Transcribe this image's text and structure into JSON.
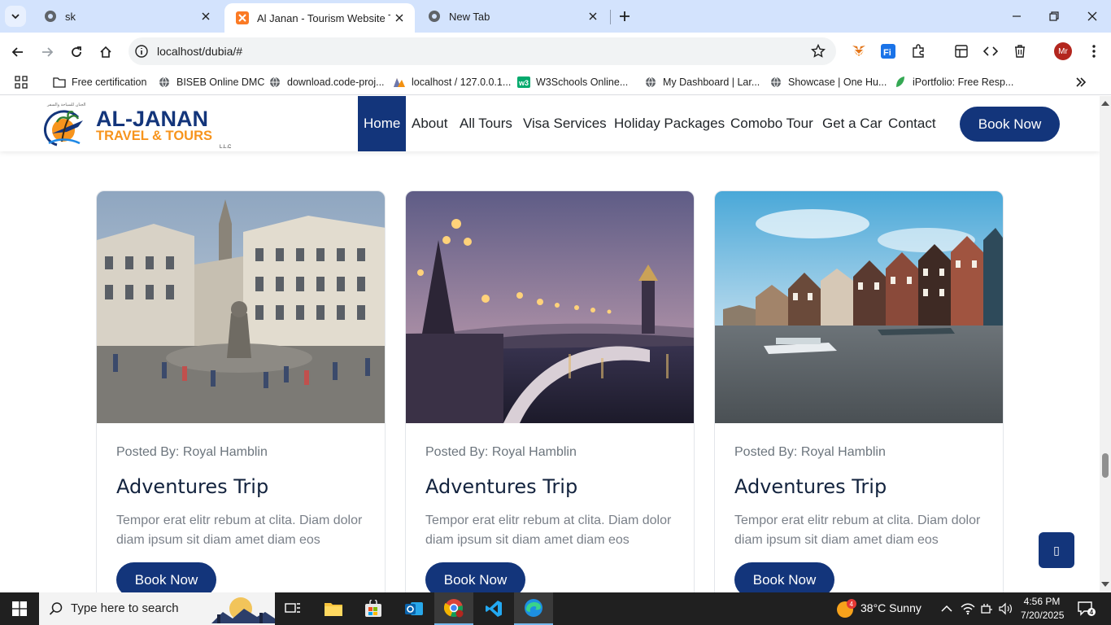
{
  "browser": {
    "tabs": [
      {
        "title": "sk",
        "icon": "chrome-favicon",
        "active": false
      },
      {
        "title": "Al Janan - Tourism Website Ten",
        "icon": "xampp-favicon",
        "active": true
      },
      {
        "title": "New Tab",
        "icon": "chrome-favicon",
        "active": false
      }
    ],
    "url": "localhost/dubia/#",
    "bookmarks": [
      {
        "label": "Free certification",
        "icon": "folder-icon"
      },
      {
        "label": "BISEB Online DMC",
        "icon": "globe-icon"
      },
      {
        "label": "download.code-proj...",
        "icon": "globe-icon"
      },
      {
        "label": "localhost / 127.0.0.1...",
        "icon": "phpmyadmin-icon"
      },
      {
        "label": "W3Schools Online...",
        "icon": "w3schools-icon"
      },
      {
        "label": "My Dashboard | Lar...",
        "icon": "globe-icon"
      },
      {
        "label": "Showcase | One Hu...",
        "icon": "globe-icon"
      },
      {
        "label": "iPortfolio: Free Resp...",
        "icon": "leaf-icon"
      }
    ],
    "profile_initials": "Mr"
  },
  "site": {
    "brand": {
      "name": "AL-JANAN",
      "tagline": "TRAVEL & TOURS",
      "suffix": "L.L.C"
    },
    "nav": [
      {
        "label": "Home",
        "active": true
      },
      {
        "label": "About"
      },
      {
        "label": "All Tours"
      },
      {
        "label": "Visa Services"
      },
      {
        "label": "Holiday Packages"
      },
      {
        "label": "Comobo Tour"
      },
      {
        "label": "Get a Car"
      },
      {
        "label": "Contact"
      }
    ],
    "cta": "Book Now",
    "cards": [
      {
        "image": "city-square-fountain-photo",
        "posted_by": "Posted By: Royal Hamblin",
        "title": "Adventures Trip",
        "text": "Tempor erat elitr rebum at clita. Diam dolor diam ipsum sit diam amet diam eos",
        "button": "Book Now"
      },
      {
        "image": "bridge-at-dusk-photo",
        "posted_by": "Posted By: Royal Hamblin",
        "title": "Adventures Trip",
        "text": "Tempor erat elitr rebum at clita. Diam dolor diam ipsum sit diam amet diam eos",
        "button": "Book Now"
      },
      {
        "image": "canal-houses-boat-photo",
        "posted_by": "Posted By: Royal Hamblin",
        "title": "Adventures Trip",
        "text": "Tempor erat elitr rebum at clita. Diam dolor diam ipsum sit diam amet diam eos",
        "button": "Book Now"
      }
    ],
    "back_to_top_glyph": "▯",
    "colors": {
      "primary": "#13357b",
      "text": "#212529",
      "muted": "#6c757d"
    }
  },
  "taskbar": {
    "search_placeholder": "Type here to search",
    "weather": "38°C  Sunny",
    "weather_badge": "4",
    "time": "4:56 PM",
    "date": "7/20/2025",
    "notification_count": "4"
  }
}
